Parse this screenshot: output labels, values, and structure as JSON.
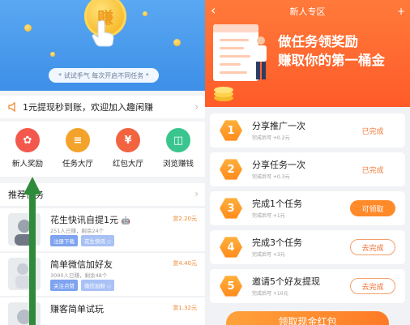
{
  "left": {
    "hero": {
      "coin_char": "赚",
      "hint": "* 试试手气 每次开启不同任务 *"
    },
    "notice": {
      "text": "1元提现秒到账，欢迎加入趣闲赚"
    },
    "grid": [
      {
        "label": "新人奖励",
        "icon": "gift-icon",
        "color": "#f4584c",
        "glyph": "✿"
      },
      {
        "label": "任务大厅",
        "icon": "clipboard-icon",
        "color": "#f4a32a",
        "glyph": "≡"
      },
      {
        "label": "红包大厅",
        "icon": "red-envelope-icon",
        "color": "#f2633f",
        "glyph": "¥"
      },
      {
        "label": "浏览赚钱",
        "icon": "browser-icon",
        "color": "#3ac58e",
        "glyph": "◫"
      }
    ],
    "recommended_title": "推荐任务",
    "tasks": [
      {
        "title": "花生快讯自提1元",
        "meta": "251人已赚，剩余24个",
        "tags": [
          "注册下载",
          "花生快讯 ◇"
        ],
        "price": "赏2.20元"
      },
      {
        "title": "简单微信加好友",
        "meta": "3090人已赚，剩余48个",
        "tags": [
          "关注点赞",
          "微信加粉 ◇"
        ],
        "price": "赏4.40元"
      },
      {
        "title": "赚客简单试玩",
        "meta": "",
        "tags": [],
        "price": "赏1.32元"
      }
    ]
  },
  "right": {
    "header": {
      "back": "‹",
      "title": "新人专区",
      "plus": "+",
      "slogan_line1": "做任务领奖励",
      "slogan_line2": "赚取你的第一桶金"
    },
    "tasks": [
      {
        "number": "1",
        "title": "分享推广一次",
        "reward": "完成后可 +0.2元",
        "status": "已完成",
        "state": "done"
      },
      {
        "number": "2",
        "title": "分享任务一次",
        "reward": "完成后可 +0.3元",
        "status": "已完成",
        "state": "done"
      },
      {
        "number": "3",
        "title": "完成1个任务",
        "reward": "完成后可 +1元",
        "status": "可领取",
        "state": "claim"
      },
      {
        "number": "4",
        "title": "完成3个任务",
        "reward": "完成后可 +3元",
        "status": "去完成",
        "state": "go"
      },
      {
        "number": "5",
        "title": "邀请5个好友提现",
        "reward": "完成后可 +10元",
        "status": "去完成",
        "state": "go"
      }
    ],
    "cta": "领取现金红包"
  },
  "colors": {
    "left_banner": "#4a9bee",
    "right_banner": "#ff6a32",
    "accent_orange": "#ff8a2a",
    "arrow_green": "#2f8a3a"
  }
}
